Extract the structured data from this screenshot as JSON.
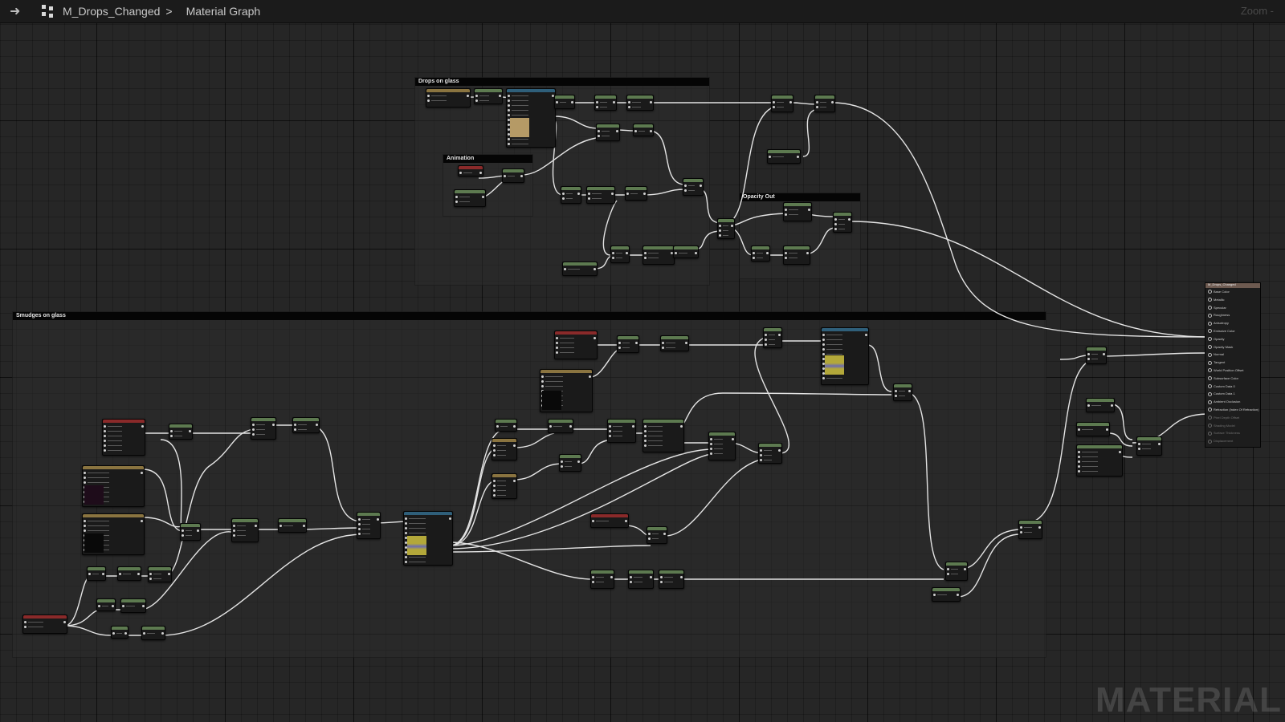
{
  "toolbar": {
    "back_icon": "back-arrow-icon",
    "graph_icon": "graph-icon",
    "asset_name": "M_Drops_Changed",
    "separator": ">",
    "graph_name": "Material Graph",
    "zoom_label": "Zoom -"
  },
  "comments": {
    "drops": "Drops on glass",
    "animation": "Animation",
    "opacity": "Opacity Out",
    "smudges": "Smudges on glass"
  },
  "result_node": {
    "pins": [
      "Base Color",
      "Metallic",
      "Specular",
      "Roughness",
      "Anisotropy",
      "Emissive Color",
      "Opacity",
      "Opacity Mask",
      "Normal",
      "Tangent",
      "World Position Offset",
      "Subsurface Color",
      "Custom Data 0",
      "Custom Data 1",
      "Ambient Occlusion",
      "Refraction (Index Of Refraction)",
      "Pixel Depth Offset",
      "Shading Model",
      "Surface Thickness",
      "Displacement"
    ]
  },
  "watermark": "MATERIAL",
  "colors": {
    "math_header": "#5d7a50",
    "texture_header": "#2f5f7a",
    "input_header": "#8a2a2a",
    "param_header": "#8a7440",
    "wire": "#e8e8e8"
  }
}
